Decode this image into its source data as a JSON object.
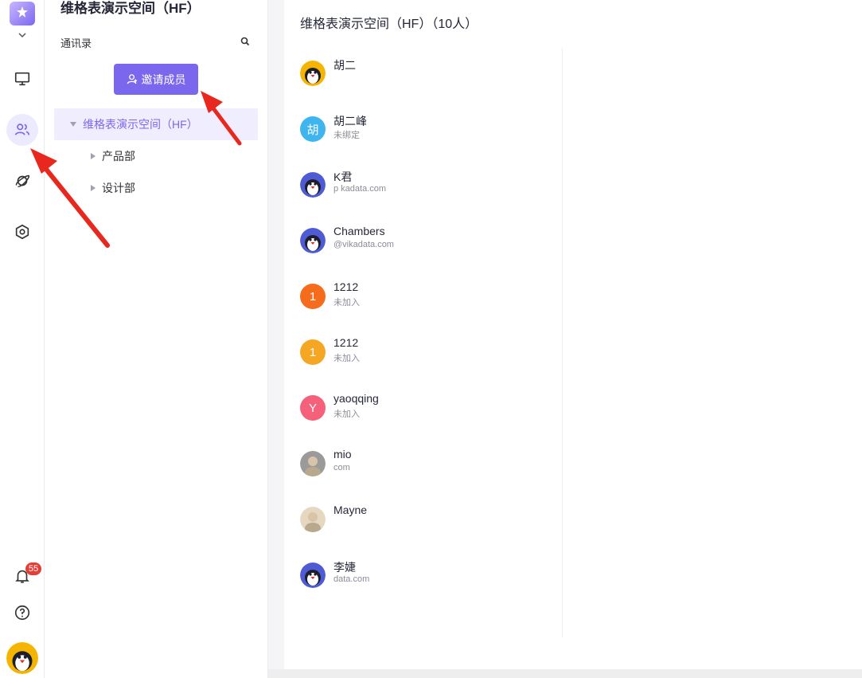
{
  "rail": {
    "notification_count": "55",
    "icons": [
      "monitor-icon",
      "contacts-icon",
      "rocket-icon",
      "settings-icon",
      "bell-icon",
      "help-icon"
    ],
    "active": "contacts-icon"
  },
  "panel": {
    "space_title": "维格表演示空间（HF）",
    "contacts_label": "通讯录",
    "invite_label": "邀请成员",
    "tree": {
      "root": "维格表演示空间（HF）",
      "children": [
        "产品部",
        "设计部"
      ]
    }
  },
  "main": {
    "title": "维格表演示空间（HF）（10人）",
    "members": [
      {
        "name": "胡二",
        "sub": "",
        "avatar": "penguin",
        "color": "#f5b400"
      },
      {
        "name": "胡二峰",
        "sub": "未绑定",
        "avatar": "胡",
        "color": "#3fb5f0"
      },
      {
        "name": "K君",
        "sub": "p              kadata.com",
        "avatar": "penguin",
        "color": "#4f5bd5"
      },
      {
        "name": "Chambers",
        "sub": "@vikadata.com",
        "avatar": "penguin",
        "color": "#4f5bd5"
      },
      {
        "name": "1212",
        "sub": "未加入",
        "avatar": "1",
        "color": "#f56c1d"
      },
      {
        "name": "1212",
        "sub": "未加入",
        "avatar": "1",
        "color": "#f5a623"
      },
      {
        "name": "yaoqqing",
        "sub": "未加入",
        "avatar": "Y",
        "color": "#f5607a"
      },
      {
        "name": "mio",
        "sub": "com",
        "avatar": "photo",
        "color": "#9a9a9a"
      },
      {
        "name": "Mayne",
        "sub": "",
        "avatar": "photo",
        "color": "#e6d8c0"
      },
      {
        "name": "李婕",
        "sub": "data.com",
        "avatar": "penguin",
        "color": "#4f5bd5"
      }
    ]
  },
  "colors": {
    "accent": "#7b67ee",
    "arrow": "#e8281e",
    "badge": "#e33e38"
  }
}
